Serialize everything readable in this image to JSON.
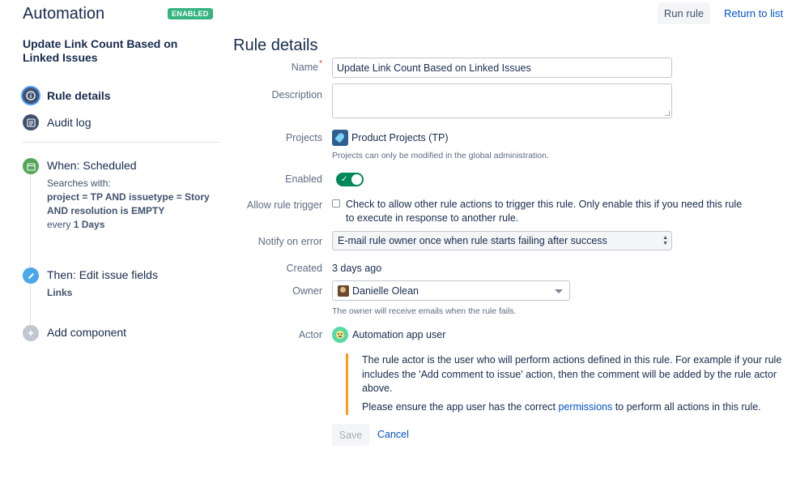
{
  "header": {
    "title": "Automation",
    "badge": "ENABLED",
    "run_rule": "Run rule",
    "return_to_list": "Return to list"
  },
  "sidebar": {
    "rule_name": "Update Link Count Based on Linked Issues",
    "nav": [
      {
        "label": "Rule details",
        "icon": "info-icon",
        "active": true
      },
      {
        "label": "Audit log",
        "icon": "log-icon",
        "active": false
      }
    ],
    "components": {
      "when": {
        "title": "When: Scheduled",
        "searches_with": "Searches with:",
        "jql_line1": "project = TP AND issuetype = Story",
        "jql_line2": "AND resolution is EMPTY",
        "every_prefix": "every",
        "every_value": "1 Days",
        "color": "#57a55a"
      },
      "then": {
        "title": "Then: Edit issue fields",
        "detail": "Links",
        "color": "#4aa7e8"
      },
      "add": {
        "title": "Add component",
        "color": "#c1c7d0"
      }
    }
  },
  "form": {
    "section_title": "Rule details",
    "name_label": "Name",
    "name_value": "Update Link Count Based on Linked Issues",
    "description_label": "Description",
    "description_value": "",
    "projects_label": "Projects",
    "project_value": "Product Projects (TP)",
    "projects_help": "Projects can only be modified in the global administration.",
    "enabled_label": "Enabled",
    "enabled": true,
    "allow_trigger_label": "Allow rule trigger",
    "allow_trigger_text": "Check to allow other rule actions to trigger this rule. Only enable this if you need this rule to execute in response to another rule.",
    "allow_trigger_checked": false,
    "notify_label": "Notify on error",
    "notify_value": "E-mail rule owner once when rule starts failing after success",
    "created_label": "Created",
    "created_value": "3 days ago",
    "owner_label": "Owner",
    "owner_value": "Danielle Olean",
    "owner_help": "The owner will receive emails when the rule fails.",
    "actor_label": "Actor",
    "actor_value": "Automation app user",
    "note_p1": "The rule actor is the user who will perform actions defined in this rule. For example if your rule includes the 'Add comment to issue' action, then the comment will be added by the rule actor above.",
    "note_p2_before": "Please ensure the app user has the correct",
    "note_p2_link": "permissions",
    "note_p2_after": "to perform all actions in this rule.",
    "save": "Save",
    "cancel": "Cancel"
  },
  "colors": {
    "accent": "#0052cc",
    "enabled_green": "#36b37e",
    "toggle_green": "#00875a",
    "note_border": "#ff991f"
  }
}
